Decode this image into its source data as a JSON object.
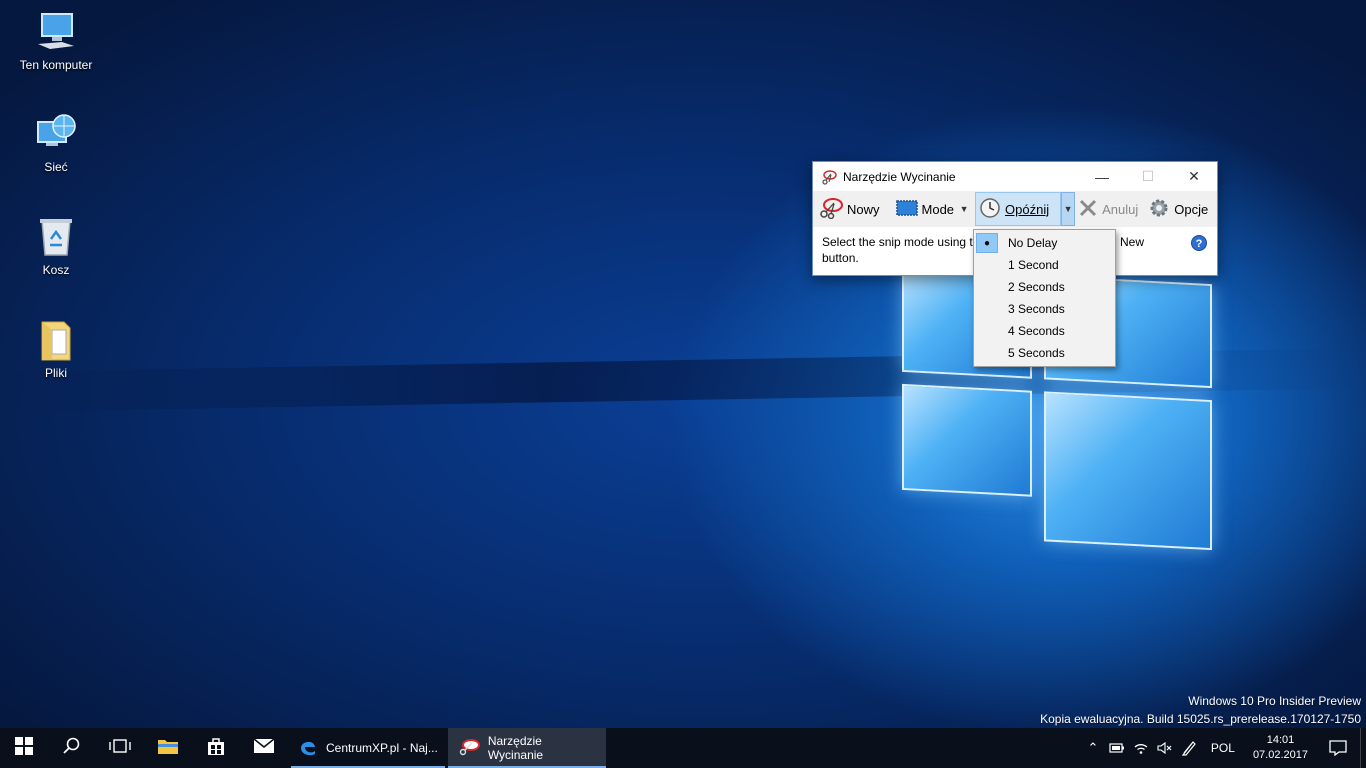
{
  "desktop": {
    "icons": [
      {
        "label": "Ten komputer",
        "icon": "computer-icon"
      },
      {
        "label": "Sieć",
        "icon": "network-icon"
      },
      {
        "label": "Kosz",
        "icon": "recycle-bin-icon"
      },
      {
        "label": "Pliki",
        "icon": "folder-icon"
      }
    ]
  },
  "snip_window": {
    "title": "Narzędzie Wycinanie",
    "buttons": {
      "new": "Nowy",
      "mode": "Mode",
      "delay": "Opóźnij",
      "cancel": "Anuluj",
      "options": "Opcje"
    },
    "description_line1": "Select the snip mode using th",
    "description_tail": "New",
    "description_line2": "button.",
    "help": "?",
    "minimize": "—",
    "maximize": "☐",
    "close": "✕"
  },
  "delay_menu": {
    "items": [
      "No Delay",
      "1 Second",
      "2 Seconds",
      "3 Seconds",
      "4 Seconds",
      "5 Seconds"
    ],
    "selected_index": 0
  },
  "watermark": {
    "line1": "Windows 10 Pro Insider Preview",
    "line2": "Kopia ewaluacyjna. Build 15025.rs_prerelease.170127-1750"
  },
  "taskbar": {
    "tasks": [
      {
        "label": "CentrumXP.pl - Naj...",
        "icon": "edge-icon"
      },
      {
        "label": "Narzędzie Wycinanie",
        "icon": "snipping-tool-icon",
        "active": true
      }
    ],
    "language": "POL",
    "time": "14:01",
    "date": "07.02.2017"
  },
  "colors": {
    "accent": "#0078d7",
    "taskbar": "#0a0f1c",
    "menu_highlight": "#90c8f6"
  }
}
